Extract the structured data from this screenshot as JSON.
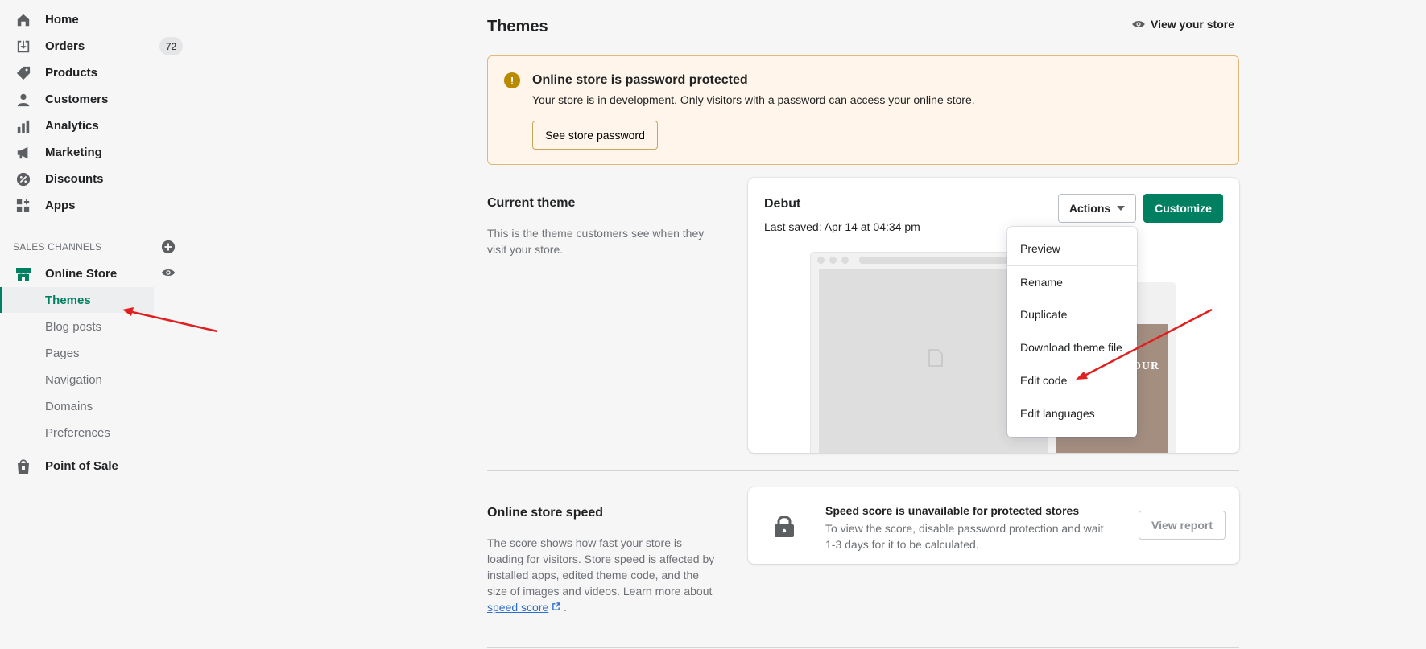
{
  "sidebar": {
    "items": [
      {
        "label": "Home",
        "icon": "home-icon"
      },
      {
        "label": "Orders",
        "icon": "orders-icon",
        "badge": "72"
      },
      {
        "label": "Products",
        "icon": "tag-icon"
      },
      {
        "label": "Customers",
        "icon": "person-icon"
      },
      {
        "label": "Analytics",
        "icon": "bar-chart-icon"
      },
      {
        "label": "Marketing",
        "icon": "megaphone-icon"
      },
      {
        "label": "Discounts",
        "icon": "discount-icon"
      },
      {
        "label": "Apps",
        "icon": "apps-icon"
      }
    ],
    "section_heading": "SALES CHANNELS",
    "online_store": "Online Store",
    "sub_items": [
      "Themes",
      "Blog posts",
      "Pages",
      "Navigation",
      "Domains",
      "Preferences"
    ],
    "point_of_sale": "Point of Sale"
  },
  "header": {
    "title": "Themes",
    "view_store": "View your store"
  },
  "banner": {
    "title": "Online store is password protected",
    "text": "Your store is in development. Only visitors with a password can access your online store.",
    "button": "See store password"
  },
  "current_theme": {
    "heading": "Current theme",
    "description_line1": "This is the theme customers see when they",
    "description_line2": "visit your store.",
    "theme_name": "Debut",
    "last_saved": "Last saved: Apr 14 at 04:34 pm",
    "actions_label": "Actions",
    "customize_label": "Customize",
    "mobile_brand": "OUR"
  },
  "actions_menu": [
    "Preview",
    "Rename",
    "Duplicate",
    "Download theme file",
    "Edit code",
    "Edit languages"
  ],
  "speed": {
    "heading": "Online store speed",
    "desc_lines": [
      "The score shows how fast your store is",
      "loading for visitors. Store speed is affected by",
      "installed apps, edited theme code, and the",
      "size of images and videos. Learn more about"
    ],
    "link": "speed score",
    "link_suffix": " .",
    "card_title": "Speed score is unavailable for protected stores",
    "card_text": "To view the score, disable password protection and wait 1-3 days for it to be calculated.",
    "report_button": "View report"
  },
  "colors": {
    "accent": "#008060",
    "annotation": "#e02020"
  }
}
